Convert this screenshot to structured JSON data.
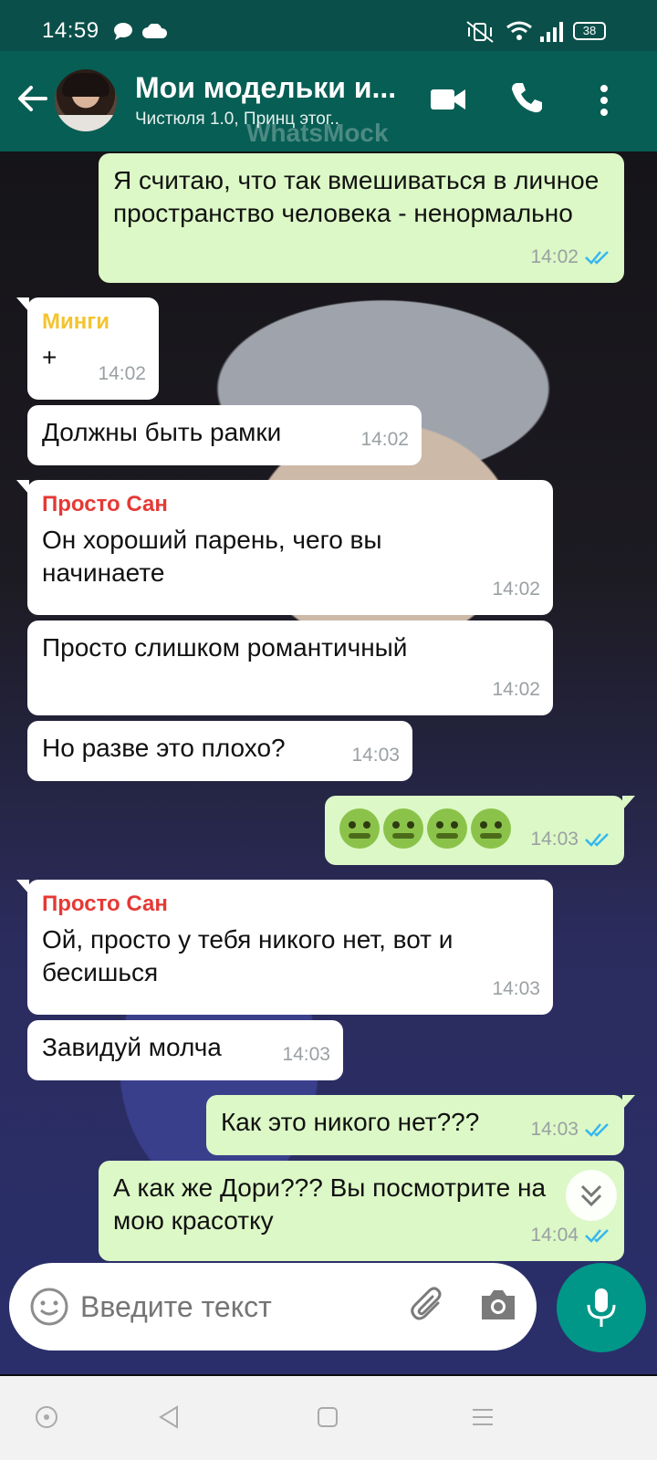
{
  "status_bar": {
    "time": "14:59",
    "battery": "38"
  },
  "header": {
    "title": "Мои модельки и...",
    "subtitle": "Чистюля 1.0, Принц этог..",
    "watermark": "WhatsMock"
  },
  "messages": [
    {
      "direction": "out",
      "text": "Я считаю, что так вмешиваться в личное пространство человека - ненормально",
      "time": "14:02",
      "read": true
    },
    {
      "direction": "in",
      "sender": "Минги",
      "sender_color": "#f4c430",
      "text": "+",
      "time": "14:02"
    },
    {
      "direction": "in",
      "text": "Должны быть рамки",
      "time": "14:02"
    },
    {
      "direction": "in",
      "sender": "Просто Сан",
      "sender_color": "#e53935",
      "text": "Он хороший парень, чего вы начинаете",
      "time": "14:02"
    },
    {
      "direction": "in",
      "text": "Просто слишком романтичный",
      "time": "14:02"
    },
    {
      "direction": "in",
      "text": "Но разве это плохо?",
      "time": "14:03"
    },
    {
      "direction": "out",
      "emoji": "nauseated-face x4",
      "time": "14:03",
      "read": true
    },
    {
      "direction": "in",
      "sender": "Просто Сан",
      "sender_color": "#e53935",
      "text": "Ой, просто у тебя никого нет, вот и бесишься",
      "time": "14:03"
    },
    {
      "direction": "in",
      "text": "Завидуй молча",
      "time": "14:03"
    },
    {
      "direction": "out",
      "text": "Как это никого нет???",
      "time": "14:03",
      "read": true
    },
    {
      "direction": "out",
      "text": "А как же Дори??? Вы посмотрите на мою красотку",
      "time": "14:04",
      "read": true
    }
  ],
  "input": {
    "placeholder": "Введите текст"
  },
  "colors": {
    "header": "#075e54",
    "status_bar": "#0a4f4a",
    "outgoing": "#dcf8c6",
    "incoming": "#ffffff",
    "accent": "#009688",
    "read_tick": "#34b7f1"
  }
}
